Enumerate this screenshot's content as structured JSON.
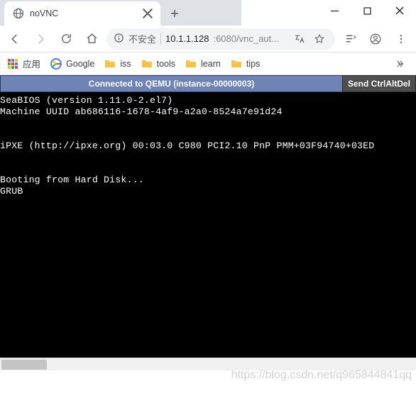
{
  "window": {
    "title": "noVNC"
  },
  "tabs": [
    {
      "title": "noVNC"
    }
  ],
  "omnibox": {
    "insecure_label": "不安全",
    "host": "10.1.1.128",
    "port_path": ":6080/vnc_aut..."
  },
  "bookmarks": {
    "apps_label": "应用",
    "items": [
      {
        "label": "Google",
        "icon": "google"
      },
      {
        "label": "iss",
        "icon": "folder"
      },
      {
        "label": "tools",
        "icon": "folder"
      },
      {
        "label": "learn",
        "icon": "folder"
      },
      {
        "label": "tips",
        "icon": "folder"
      }
    ]
  },
  "vnc": {
    "status": "Connected to QEMU (instance-00000003)",
    "send_btn": "Send CtrlAltDel"
  },
  "terminal": {
    "lines": [
      "SeaBIOS (version 1.11.0-2.el7)",
      "Machine UUID ab686116-1678-4af9-a2a0-8524a7e91d24",
      "",
      "",
      "iPXE (http://ipxe.org) 00:03.0 C980 PCI2.10 PnP PMM+03F94740+03ED",
      "",
      "",
      "Booting from Hard Disk...",
      "GRUB"
    ]
  },
  "watermark": "https://blog.csdn.net/q965844841qq"
}
